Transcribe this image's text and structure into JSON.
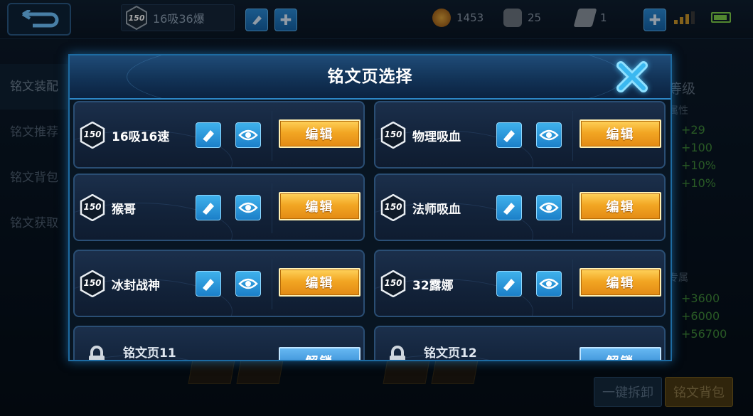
{
  "header": {
    "page_name": "16吸36爆",
    "page_level": "150",
    "resources": [
      {
        "name": "gold-coin",
        "value": "1453"
      },
      {
        "name": "diamond",
        "value": "25"
      },
      {
        "name": "fragment",
        "value": "1"
      }
    ]
  },
  "sidebar": {
    "items": [
      {
        "label": "铭文装配"
      },
      {
        "label": "铭文推荐"
      },
      {
        "label": "铭文背包"
      },
      {
        "label": "铭文获取"
      }
    ]
  },
  "right_panel": {
    "heading": "等级",
    "sub1": "属性",
    "stats1": [
      "+29",
      "+100",
      "+10%",
      "+10%"
    ],
    "sub2": "专属",
    "stats2": [
      "+3600",
      "+6000",
      "+56700"
    ]
  },
  "bottom": {
    "dismantle_label": "一键拆卸",
    "bag_label": "铭文背包"
  },
  "modal": {
    "title": "铭文页选择",
    "edit_label": "编辑",
    "unlock_label": "解锁",
    "pages": [
      {
        "level": "150",
        "name": "16吸16速"
      },
      {
        "level": "150",
        "name": "物理吸血"
      },
      {
        "level": "150",
        "name": "猴哥"
      },
      {
        "level": "150",
        "name": "法师吸血"
      },
      {
        "level": "150",
        "name": "冰封战神"
      },
      {
        "level": "150",
        "name": "32露娜"
      }
    ],
    "locked_pages": [
      {
        "name": "铭文页11"
      },
      {
        "name": "铭文页12"
      }
    ]
  },
  "colors": {
    "accent_blue": "#2c86c6",
    "edit_gold": "#f2a623",
    "unlock_blue": "#2178c6"
  }
}
